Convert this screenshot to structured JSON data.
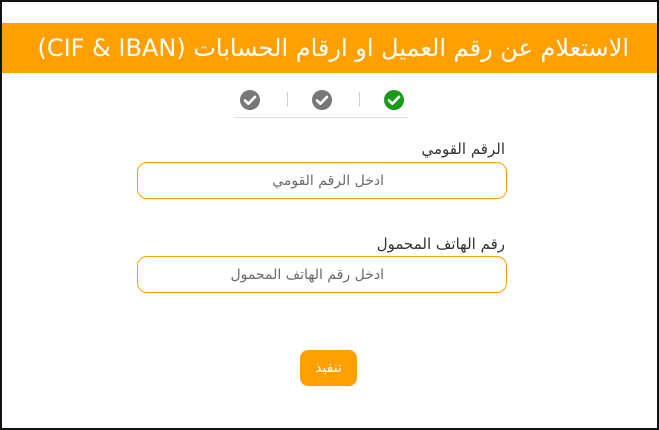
{
  "header": {
    "title": "الاستعلام عن رقم العميل او ارقام الحسابات (CIF & IBAN)"
  },
  "steps": [
    {
      "icon": "check-circle-icon",
      "state": "completed",
      "color": "#777777"
    },
    {
      "icon": "check-circle-icon",
      "state": "completed",
      "color": "#777777"
    },
    {
      "icon": "check-circle-icon",
      "state": "active",
      "color": "#1a9a1a"
    }
  ],
  "form": {
    "national_id": {
      "label": "الرقم القومي",
      "placeholder": "ادخل الرقم القومي",
      "value": ""
    },
    "mobile": {
      "label": "رقم الهاتف المحمول",
      "placeholder": "ادخل رقم الهاتف المحمول",
      "value": ""
    },
    "submit_label": "تنفيذ"
  },
  "colors": {
    "accent": "#FFA000",
    "text": "#333333",
    "success": "#1a9a1a",
    "inactive": "#777777"
  }
}
